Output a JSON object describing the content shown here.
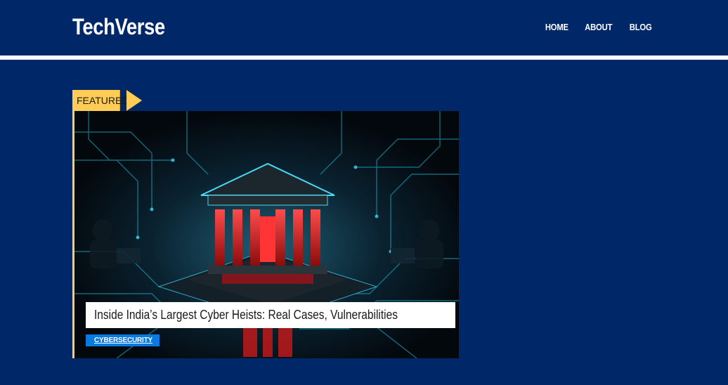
{
  "site": {
    "logo": "TechVerse"
  },
  "nav": [
    {
      "label": "HOME"
    },
    {
      "label": "ABOUT"
    },
    {
      "label": "BLOG"
    }
  ],
  "featured": {
    "tag": "FEATURED",
    "title": "Inside India’s Largest Cyber Heists: Real Cases, Vulnerabilities",
    "category": "CYBERSECURITY",
    "image_icon": "bank-circuit-image"
  },
  "colors": {
    "background": "#002868",
    "accent": "#ffcc55",
    "badge": "#0a7ae0"
  }
}
